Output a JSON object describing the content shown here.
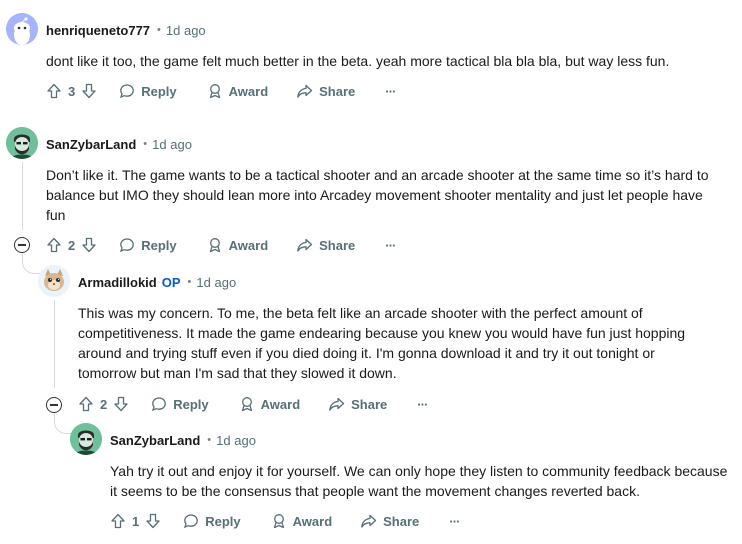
{
  "comments": [
    {
      "author": "henriqueneto777",
      "time": "1d ago",
      "text": "dont like it too, the game felt much better in the beta. yeah more tactical bla bla bla, but way less fun.",
      "score": "3",
      "reply_label": "Reply",
      "award_label": "Award",
      "share_label": "Share",
      "more_label": "···"
    },
    {
      "author": "SanZybarLand",
      "time": "1d ago",
      "text": "Don’t like it. The game wants to be a tactical shooter and an arcade shooter at the same time so it’s hard to balance but IMO they should lean more into Arcadey movement shooter mentality and just let people have fun",
      "score": "2",
      "reply_label": "Reply",
      "award_label": "Award",
      "share_label": "Share",
      "more_label": "···"
    },
    {
      "author": "Armadillokid",
      "op_badge": "OP",
      "time": "1d ago",
      "text": "This was my concern. To me, the beta felt like an arcade shooter with the perfect amount of competitiveness. It made the game endearing because you knew you would have fun just hopping around and trying stuff even if you died doing it. I'm gonna download it and try it out tonight or tomorrow but man I'm sad that they slowed it down.",
      "score": "2",
      "reply_label": "Reply",
      "award_label": "Award",
      "share_label": "Share",
      "more_label": "···"
    },
    {
      "author": "SanZybarLand",
      "time": "1d ago",
      "text": "Yah try it out and enjoy it for yourself. We can only hope they listen to community feedback because it seems to be the consensus that people want the movement changes reverted back.",
      "score": "1",
      "reply_label": "Reply",
      "award_label": "Award",
      "share_label": "Share",
      "more_label": "···"
    }
  ],
  "separator": "•",
  "colors": {
    "op_badge": "#0a59c7",
    "meta_gray": "#576f76",
    "thread_line": "#d6dbde"
  }
}
